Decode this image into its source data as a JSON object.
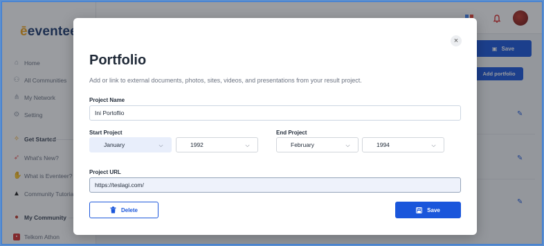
{
  "app": {
    "logo_text": "eventee",
    "logo_initial": "e"
  },
  "sidebar": {
    "items": [
      {
        "label": "Home",
        "icon": "home-icon"
      },
      {
        "label": "All Communities",
        "icon": "people-icon"
      },
      {
        "label": "My Network",
        "icon": "network-icon"
      },
      {
        "label": "Setting",
        "icon": "gear-icon"
      }
    ],
    "get_started": {
      "label": "Get Started",
      "items": [
        {
          "label": "What's New?",
          "icon": "rocket-icon"
        },
        {
          "label": "What is Eventeer?",
          "icon": "hands-icon"
        },
        {
          "label": "Community Tutorial",
          "icon": "graduation-cap-icon"
        }
      ]
    },
    "my_community": {
      "label": "My Community",
      "items": [
        {
          "label": "Telkom Athon",
          "icon": "community-logo-icon"
        }
      ]
    }
  },
  "background": {
    "save_label": "Save",
    "add_portfolio_label": "Add portfolio"
  },
  "modal": {
    "close_symbol": "×",
    "title": "Portfolio",
    "subtitle": "Add or link to external documents, photos, sites, videos, and presentations from your result project.",
    "project_name": {
      "label": "Project Name",
      "value": "Ini Portoflio"
    },
    "start_project": {
      "label": "Start Project",
      "month": "January",
      "year": "1992"
    },
    "end_project": {
      "label": "End Project",
      "month": "February",
      "year": "1994"
    },
    "project_url": {
      "label": "Project URL",
      "value": "https://teslagi.com/"
    },
    "delete_label": "Delete",
    "save_label": "Save"
  },
  "colors": {
    "primary": "#1a56db",
    "logo_accent": "#f2a51a"
  }
}
